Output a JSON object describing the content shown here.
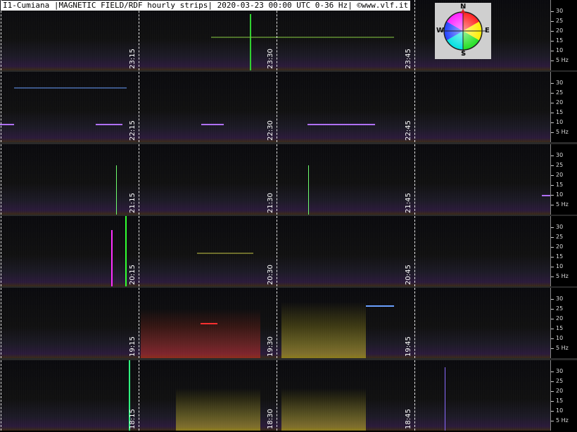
{
  "header": {
    "title": "I1-Cumiana |MAGNETIC FIELD/RDF hourly strips| 2020-03-23 00:00 UTC 0-36 Hz| ©www.vlf.it"
  },
  "compass": {
    "north": "N",
    "south": "S",
    "east": "E",
    "west": "W"
  },
  "scale_labels": [
    "30",
    "25",
    "20",
    "15",
    "10",
    "5 Hz"
  ],
  "strips": [
    {
      "times": [
        "23:15",
        "23:30",
        "23:45"
      ]
    },
    {
      "times": [
        "22:15",
        "22:30",
        "22:45"
      ]
    },
    {
      "times": [
        "21:15",
        "21:30",
        "21:45"
      ]
    },
    {
      "times": [
        "20:15",
        "20:30",
        "20:45"
      ]
    },
    {
      "times": [
        "19:15",
        "19:30",
        "19:45"
      ]
    },
    {
      "times": [
        "18:15",
        "18:30",
        "18:45"
      ]
    }
  ],
  "colors": {
    "background": "#000000",
    "carrier_purple": "#b070ff",
    "carrier_green": "#7fbf3f",
    "burst_red": "#d03020",
    "burst_yellow": "#d0c020"
  }
}
